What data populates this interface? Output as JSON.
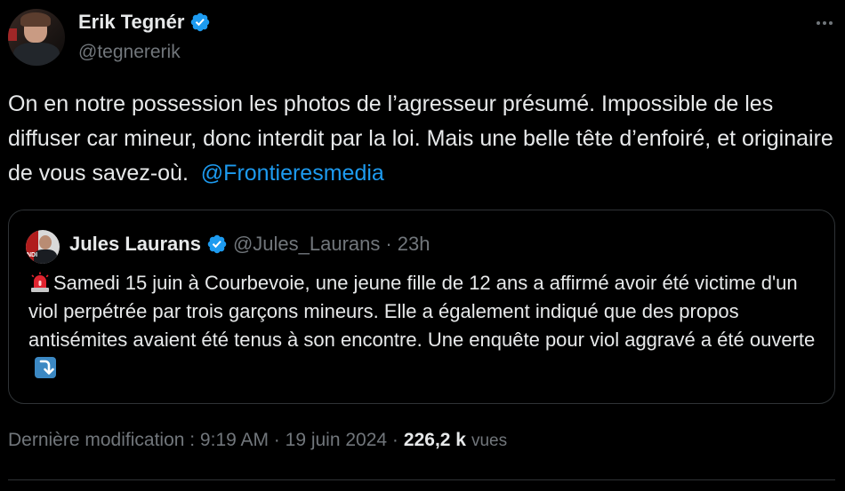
{
  "author": {
    "display_name": "Erik Tegnér",
    "handle": "@tegnererik",
    "verified": true
  },
  "tweet": {
    "text_main": "On en notre possession les photos de l’agresseur présumé. Impossible de les diffuser car mineur, donc interdit par la loi. Mais une belle tête d’enfoiré, et originaire de vous savez-où.  ",
    "mention": "@Frontieresmedia"
  },
  "quoted_tweet": {
    "display_name": "Jules Laurans",
    "handle": "@Jules_Laurans",
    "separator": "·",
    "time": "23h",
    "verified": true,
    "avatar_text": "NDI",
    "text": "Samedi 15 juin à Courbevoie, une jeune fille de 12 ans a affirmé avoir été victime d'un viol perpétrée par trois garçons mineurs. Elle a également indiqué que des propos antisémites avaient été tenus à son encontre. Une enquête pour viol aggravé a été ouverte",
    "leading_icon": "police-siren-icon",
    "trailing_icon": "arrow-down-right-icon"
  },
  "meta": {
    "label": "Dernière modification : 9:19 AM · 19 juin 2024 ·",
    "views_count": "226,2 k",
    "views_label": "vues"
  },
  "colors": {
    "background": "#000000",
    "text": "#e7e9ea",
    "secondary": "#71767b",
    "accent": "#1d9bf0",
    "border": "#2f3336"
  }
}
